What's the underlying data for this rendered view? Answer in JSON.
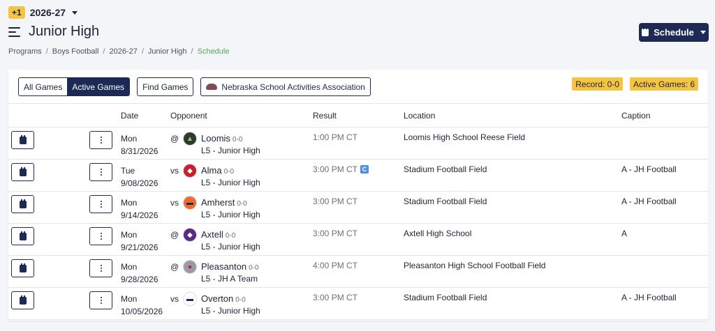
{
  "season": {
    "badge": "+1",
    "label": "2026-27"
  },
  "page_title": "Junior High",
  "schedule_button": "Schedule",
  "breadcrumb": [
    "Programs",
    "Boys Football",
    "2026-27",
    "Junior High",
    "Schedule"
  ],
  "toolbar": {
    "all_games": "All Games",
    "active_games": "Active Games",
    "find_games": "Find Games",
    "association": "Nebraska School Activities Association"
  },
  "stats": {
    "record": "Record: 0-0",
    "active": "Active Games: 6"
  },
  "columns": {
    "date": "Date",
    "opponent": "Opponent",
    "result": "Result",
    "location": "Location",
    "caption": "Caption"
  },
  "colors": {
    "navy": "#1d2a55",
    "yellow": "#f5c542",
    "green": "#58a65c",
    "badge_blue": "#4d8de8"
  },
  "games": [
    {
      "day": "Mon",
      "date": "8/31/2026",
      "ha": "@",
      "opponent": "Loomis",
      "record": "0-0",
      "level": "L5 - Junior High",
      "result": "1:00 PM CT",
      "conf": "",
      "location": "Loomis High School Reese Field",
      "caption": "",
      "logo_icon": "wolf-logo-icon"
    },
    {
      "day": "Tue",
      "date": "9/08/2026",
      "ha": "vs",
      "opponent": "Alma",
      "record": "0-0",
      "level": "L5 - Junior High",
      "result": "3:00 PM CT",
      "conf": "C",
      "location": "Stadium Football Field",
      "caption": "A - JH Football",
      "logo_icon": "cardinal-logo-icon"
    },
    {
      "day": "Mon",
      "date": "9/14/2026",
      "ha": "vs",
      "opponent": "Amherst",
      "record": "0-0",
      "level": "L5 - Junior High",
      "result": "3:00 PM CT",
      "conf": "",
      "location": "Stadium Football Field",
      "caption": "A - JH Football",
      "logo_icon": "bronco-logo-icon"
    },
    {
      "day": "Mon",
      "date": "9/21/2026",
      "ha": "@",
      "opponent": "Axtell",
      "record": "0-0",
      "level": "L5 - Junior High",
      "result": "3:00 PM CT",
      "conf": "",
      "location": "Axtell High School",
      "caption": "A",
      "logo_icon": "wildcat-logo-icon"
    },
    {
      "day": "Mon",
      "date": "9/28/2026",
      "ha": "@",
      "opponent": "Pleasanton",
      "record": "0-0",
      "level": "L5 - JH A Team",
      "result": "4:00 PM CT",
      "conf": "",
      "location": "Pleasanton High School Football Field",
      "caption": "",
      "logo_icon": "bulldog-logo-icon"
    },
    {
      "day": "Mon",
      "date": "10/05/2026",
      "ha": "vs",
      "opponent": "Overton",
      "record": "0-0",
      "level": "L5 - Junior High",
      "result": "3:00 PM CT",
      "conf": "",
      "location": "Stadium Football Field",
      "caption": "A - JH Football",
      "logo_icon": "eagle-logo-icon"
    }
  ]
}
